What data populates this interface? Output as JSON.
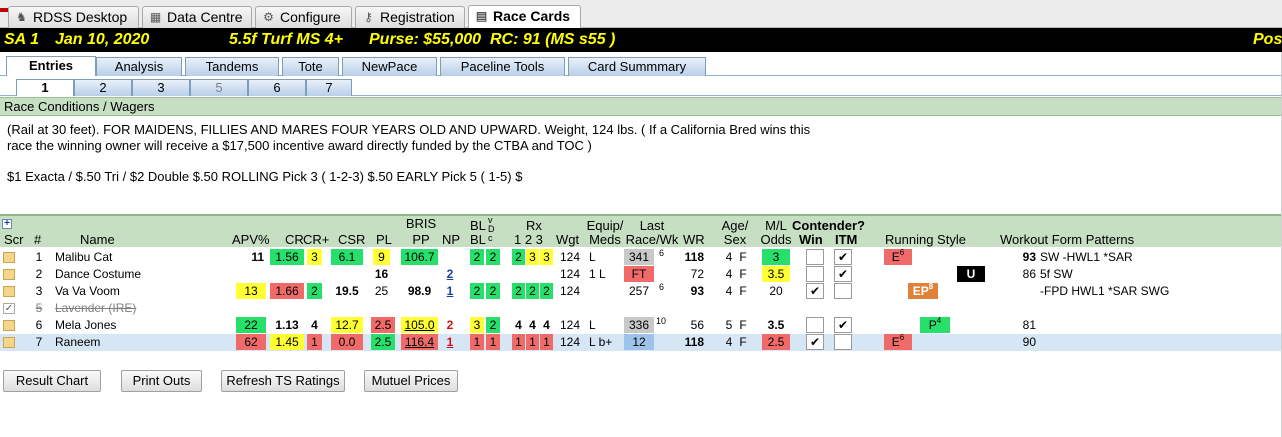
{
  "top_tabs": [
    {
      "label": "RDSS Desktop",
      "icon": "horse-icon"
    },
    {
      "label": "Data Centre",
      "icon": "database-icon"
    },
    {
      "label": "Configure",
      "icon": "gear-icon"
    },
    {
      "label": "Registration",
      "icon": "key-icon"
    },
    {
      "label": "Race Cards",
      "icon": "race-card-icon",
      "active": true
    }
  ],
  "race_header": {
    "track_race": "SA  1",
    "date": "Jan 10, 2020",
    "distance_surface": "5.5f  Turf  MS  4+",
    "purse": "Purse: $55,000",
    "rc": "RC: 91  (MS s55 )",
    "truncated_right": "Pos"
  },
  "sub_tabs": [
    "Entries",
    "Analysis",
    "Tandems",
    "Tote",
    "NewPace",
    "Paceline Tools",
    "Card Summmary"
  ],
  "race_tabs": [
    "1",
    "2",
    "3",
    "5",
    "6",
    "7"
  ],
  "conditions": {
    "section_title": "Race Conditions / Wagers",
    "line1": "(Rail at 30 feet). FOR MAIDENS, FILLIES AND MARES FOUR YEARS OLD  AND UPWARD. Weight, 124 lbs. ( If a California Bred wins this",
    "line2": "race the winning owner will receive a $17,500 incentive award directly funded by the CTBA and TOC )",
    "wagers": "$1 Exacta / $.50 Tri / $2 Double $.50 ROLLING Pick 3 ( 1-2-3) $.50 EARLY Pick 5 ( 1-5) $"
  },
  "grid_headers": {
    "plus": "+",
    "scr": "Scr",
    "num": "#",
    "name": "Name",
    "apv": "APV%",
    "cr": "CR",
    "crplus": "CR+",
    "csr": "CSR",
    "pl": "PL",
    "bris1": "BRIS",
    "bris2": "PP",
    "np": "NP",
    "bl1": "BL",
    "bl2": "BL",
    "vdc1": "v",
    "vdc2": "D",
    "vdc3": "c",
    "rx1": "Rx",
    "rx2": "1  2  3",
    "wgt": "Wgt",
    "equip1": "Equip/",
    "equip2": "Meds",
    "last1": "Last",
    "last2": "Race/Wk",
    "wr": "WR",
    "age1": "Age/",
    "age2": "Sex",
    "ml1": "M/L",
    "ml2": "Odds",
    "cont1": "Contender?",
    "win": "Win",
    "itm": "ITM",
    "running_style": "Running Style",
    "workout": "Workout Form Patterns"
  },
  "entries": [
    {
      "num": "1",
      "name": "Malibu Cat",
      "apv": "11",
      "cr": "1.56",
      "crplus": "3",
      "csr": "6.1",
      "pl": "9",
      "pp": "106.7",
      "np": "",
      "bl1": "2",
      "bl2": "2",
      "rx1": "2",
      "rx2": "3",
      "rx3": "3",
      "wgt": "124",
      "meds": "L",
      "last": "341",
      "wk": "6",
      "wr": "118",
      "age": "4",
      "sex": "F",
      "odds": "3",
      "win": "",
      "itm": "✔",
      "style": "E",
      "style_sup": "6",
      "workout_num": "93",
      "workout": "SW  -HWL1  *SAR"
    },
    {
      "num": "2",
      "name": "Dance Costume",
      "apv": "",
      "cr": "",
      "crplus": "",
      "csr": "",
      "pl": "16",
      "pp": "",
      "np": "2",
      "bl1": "",
      "bl2": "",
      "rx1": "",
      "rx2": "",
      "rx3": "",
      "wgt": "124",
      "meds": "1 L",
      "last": "FT",
      "wk": "",
      "wr": "72",
      "age": "4",
      "sex": "F",
      "odds": "3.5",
      "win": "",
      "itm": "✔",
      "style": "U",
      "style_sup": "",
      "workout_num": "86",
      "workout": "5f  SW"
    },
    {
      "num": "3",
      "name": "Va Va Voom",
      "apv": "13",
      "cr": "1.66",
      "crplus": "2",
      "csr": "19.5",
      "pl": "25",
      "pp": "98.9",
      "np": "1",
      "bl1": "2",
      "bl2": "2",
      "rx1": "2",
      "rx2": "2",
      "rx3": "2",
      "wgt": "124",
      "meds": "",
      "last": "257",
      "wk": "6",
      "wr": "93",
      "age": "4",
      "sex": "F",
      "odds": "20",
      "win": "✔",
      "itm": "",
      "style": "EP",
      "style_sup": "8",
      "workout_num": "",
      "workout": "-FPD  HWL1  *SAR  SWG"
    },
    {
      "num": "5",
      "name": "Lavender (IRE)",
      "scratched": true
    },
    {
      "num": "6",
      "name": "Mela Jones",
      "apv": "22",
      "cr": "1.13",
      "crplus": "4",
      "csr": "12.7",
      "pl": "2.5",
      "pp": "105.0",
      "np": "2",
      "bl1": "3",
      "bl2": "2",
      "rx1": "4",
      "rx2": "4",
      "rx3": "4",
      "wgt": "124",
      "meds": "L",
      "last": "336",
      "wk": "10",
      "wr": "56",
      "age": "5",
      "sex": "F",
      "odds": "3.5",
      "win": "",
      "itm": "✔",
      "style": "P",
      "style_sup": "4",
      "workout_num": "81",
      "workout": ""
    },
    {
      "num": "7",
      "name": "Raneem",
      "apv": "62",
      "cr": "1.45",
      "crplus": "1",
      "csr": "0.0",
      "pl": "2.5",
      "pp": "116.4",
      "np": "1",
      "bl1": "1",
      "bl2": "1",
      "rx1": "1",
      "rx2": "1",
      "rx3": "1",
      "wgt": "124",
      "meds": "L b+",
      "last": "12",
      "wk": "",
      "wr": "118",
      "age": "4",
      "sex": "F",
      "odds": "2.5",
      "win": "✔",
      "itm": "",
      "style": "E",
      "style_sup": "6",
      "workout_num": "90",
      "workout": ""
    }
  ],
  "buttons": [
    "Result Chart",
    "Print Outs",
    "Refresh TS Ratings",
    "Mutuel Prices"
  ],
  "colors": {
    "green": "#27e06c",
    "yellow": "#ffff33",
    "red": "#f06a6a",
    "header_bg": "#000000",
    "header_text": "#ffff00",
    "panel_green": "#c6dfc3"
  }
}
